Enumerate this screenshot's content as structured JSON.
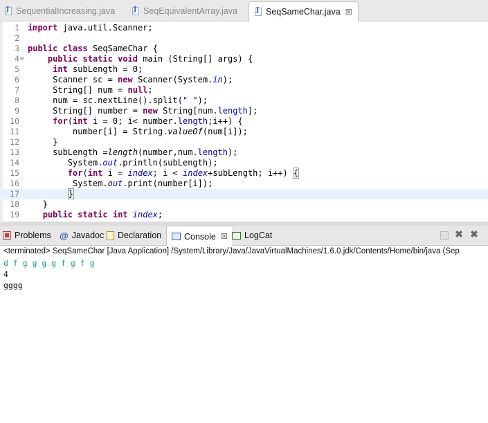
{
  "editor_tabs": [
    {
      "label": "SequentialIncreasing.java",
      "active": false
    },
    {
      "label": "SeqEquivalentArray.java",
      "active": false
    },
    {
      "label": "SeqSameChar.java",
      "active": true,
      "close": "☒"
    }
  ],
  "code_lines": [
    {
      "n": "1",
      "html": "<span class=\"kw\">import</span> java.util.Scanner;"
    },
    {
      "n": "2",
      "html": ""
    },
    {
      "n": "3",
      "html": "<span class=\"kw\">public</span> <span class=\"kw\">class</span> SeqSameChar {"
    },
    {
      "n": "4",
      "mark": "⊖",
      "html": "    <span class=\"kw\">public</span> <span class=\"kw\">static</span> <span class=\"kw\">void</span> main (String[] args) {"
    },
    {
      "n": "5",
      "html": "     <span class=\"kw\">int</span> subLength = 0;"
    },
    {
      "n": "6",
      "html": "     Scanner sc = <span class=\"kw\">new</span> Scanner(System.<span class=\"fldi\">in</span>);"
    },
    {
      "n": "7",
      "html": "     String[] num = <span class=\"kw\">null</span>;"
    },
    {
      "n": "8",
      "html": "     num = sc.nextLine().split(<span class=\"str\">\" \"</span>);"
    },
    {
      "n": "9",
      "html": "     String[] number = <span class=\"kw\">new</span> String[num.<span class=\"fld\">length</span>];"
    },
    {
      "n": "10",
      "html": "     <span class=\"kw\">for</span>(<span class=\"kw\">int</span> i = 0; i&lt; number.<span class=\"fld\">length</span>;i++) {"
    },
    {
      "n": "11",
      "html": "         number[i] = String.<span class=\"mi\">valueOf</span>(num[i]);"
    },
    {
      "n": "12",
      "html": "     }"
    },
    {
      "n": "13",
      "html": "     subLength =<span class=\"mi\">length</span>(number,num.<span class=\"fld\">length</span>);"
    },
    {
      "n": "14",
      "html": "        System.<span class=\"fldi\">out</span>.println(subLength);"
    },
    {
      "n": "15",
      "html": "        <span class=\"kw\">for</span>(<span class=\"kw\">int</span> i = <span class=\"fldi\">index</span>; i &lt; <span class=\"fldi\">index</span>+subLength; i++) <span class=\"caretbox\">{</span>"
    },
    {
      "n": "16",
      "html": "         System.<span class=\"fldi\">out</span>.print(number[i]);"
    },
    {
      "n": "17",
      "html": "        <span class=\"caretbox\">}</span>",
      "highlight": true
    },
    {
      "n": "18",
      "html": "   }"
    },
    {
      "n": "19",
      "html": "   <span class=\"kw\">public</span> <span class=\"kw\">static</span> <span class=\"kw\">int</span> <span class=\"fldi\">index</span>;"
    }
  ],
  "views": {
    "problems": "Problems",
    "javadoc": "Javadoc",
    "javadoc_icon": "@",
    "declaration": "Declaration",
    "console": "Console",
    "console_close": "☒",
    "logcat": "LogCat"
  },
  "console": {
    "header": "<terminated> SeqSameChar [Java Application] /System/Library/Java/JavaVirtualMachines/1.6.0.jdk/Contents/Home/bin/java (Sep",
    "lines": [
      {
        "text": "d f g g g g f g f g",
        "type": "input"
      },
      {
        "text": "4",
        "type": "output"
      },
      {
        "text": "gggg",
        "type": "output"
      }
    ]
  },
  "colors": {
    "keyword": "#7f0055",
    "field": "#0000c0",
    "string": "#2a00ff",
    "console_input": "#1a9f95",
    "current_line": "#e8f2fe"
  }
}
